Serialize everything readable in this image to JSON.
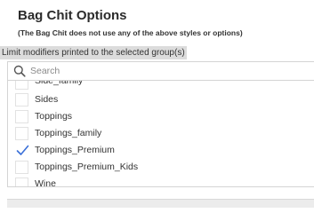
{
  "section": {
    "title": "Bag Chit Options",
    "subtitle": "(The Bag Chit does not use any of the above styles or options)"
  },
  "limit_label": "Limit modifiers printed to the selected group(s)",
  "search": {
    "placeholder": "Search",
    "value": ""
  },
  "groups": [
    {
      "label": "Side_family",
      "checked": false
    },
    {
      "label": "Sides",
      "checked": false
    },
    {
      "label": "Toppings",
      "checked": false
    },
    {
      "label": "Toppings_family",
      "checked": false
    },
    {
      "label": "Toppings_Premium",
      "checked": true
    },
    {
      "label": "Toppings_Premium_Kids",
      "checked": false
    },
    {
      "label": "Wine",
      "checked": false
    }
  ],
  "colors": {
    "checkmark": "#3a6fd8",
    "label_highlight": "#dcdcdc"
  }
}
